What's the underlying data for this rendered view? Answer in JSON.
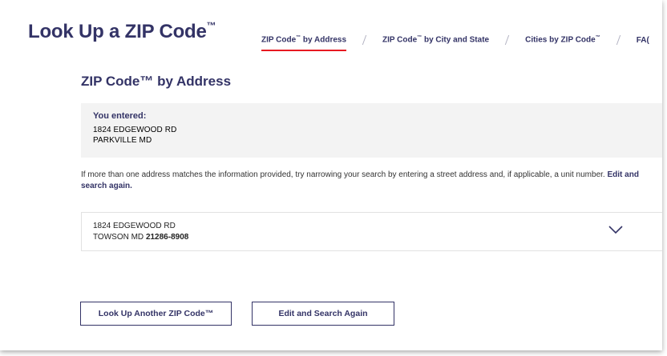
{
  "page": {
    "title": "Look Up a ZIP Code",
    "title_mark": "™"
  },
  "tabs": [
    {
      "label": "ZIP Code",
      "mark": "™",
      "suffix": " by Address",
      "active": true
    },
    {
      "label": "ZIP Code",
      "mark": "™",
      "suffix": " by City and State",
      "active": false
    },
    {
      "label": "Cities by ZIP Code",
      "mark": "™",
      "suffix": "",
      "active": false
    },
    {
      "label": "FA(",
      "mark": "",
      "suffix": "",
      "active": false
    }
  ],
  "section": {
    "title": "ZIP Code™ by Address"
  },
  "entered": {
    "label": "You entered:",
    "line1": "1824 EDGEWOOD RD",
    "line2": "PARKVILLE MD"
  },
  "info": {
    "text": "If more than one address matches the information provided, try narrowing your search by entering a street address and, if applicable, a unit number.",
    "link": "Edit and search again."
  },
  "result": {
    "line1": "1824 EDGEWOOD RD",
    "city_state": "TOWSON MD",
    "zip": "21286-8908",
    "expand_icon": "chevron-down-icon"
  },
  "buttons": {
    "lookup_another": "Look Up Another ZIP Code™",
    "edit_search": "Edit and Search Again"
  },
  "colors": {
    "brand_navy": "#333366",
    "active_underline": "#e71921",
    "entered_bg": "#f3f3f3"
  }
}
